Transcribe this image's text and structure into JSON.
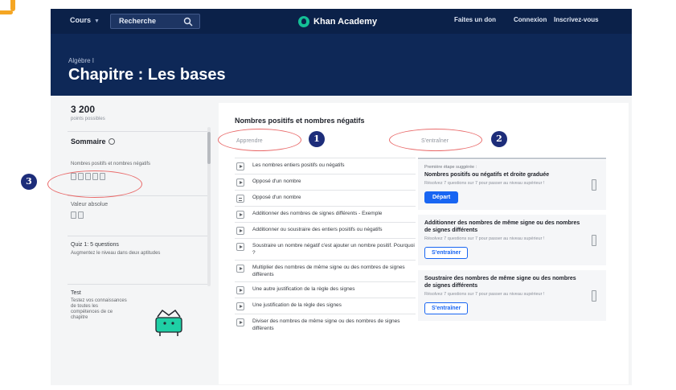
{
  "topbar": {
    "courses_label": "Cours",
    "search_placeholder": "Recherche",
    "brand": "Khan Academy",
    "donate_label": "Faites un don",
    "login_label": "Connexion",
    "signup_label": "Inscrivez-vous",
    "bg_color": "#0b2149"
  },
  "header": {
    "subtitle": "Algèbre I",
    "title": "Chapitre : Les bases",
    "bg_color": "#0e2857"
  },
  "sidebar": {
    "points": "3 200",
    "points_label": "points possibles",
    "summary_title": "Sommaire",
    "section1_label": "Nombres positifs et nombres négatifs",
    "section2_label": "Valeur absolue",
    "quiz_title": "Quiz 1: 5 questions",
    "quiz_desc": "Augmentez le niveau dans deux aptitudes",
    "test_title": "Test",
    "test_desc": "Testez vos connaissances de toutes les compétences de ce chapitre"
  },
  "annotations": [
    "1",
    "2",
    "3"
  ],
  "main": {
    "title": "Nombres positifs et nombres négatifs",
    "tab_learn": "Apprendre",
    "tab_practice": "S'entraîner",
    "rows": [
      {
        "label": "Les nombres entiers positifs ou négatifs",
        "icon": "video-icon"
      },
      {
        "label": "Opposé d'un nombre",
        "icon": "video-icon"
      },
      {
        "label": "Opposé d'un nombre",
        "icon": "article-icon"
      },
      {
        "label": "Additionner des nombres de signes différents - Exemple",
        "icon": "video-icon"
      },
      {
        "label": "Additionner ou soustraire des entiers positifs ou négatifs",
        "icon": "video-icon"
      },
      {
        "label": "Soustraire un nombre négatif c'est ajouter un nombre positif. Pourquoi ?",
        "icon": "video-icon"
      },
      {
        "label": "Multiplier des nombres de même signe ou des nombres de signes différents",
        "icon": "video-icon"
      },
      {
        "label": "Une autre justification de la règle des signes",
        "icon": "video-icon"
      },
      {
        "label": "Une justification de la règle des signes",
        "icon": "video-icon"
      },
      {
        "label": "Diviser des nombres de même signe ou des nombres de signes différents",
        "icon": "video-icon"
      }
    ],
    "cards": [
      {
        "kicker": "Première étape suggérée :",
        "title": "Nombres positifs ou négatifs et droite graduée",
        "desc": "Résolvez 7 questions sur 7 pour passer au niveau supérieur !",
        "button": "Départ",
        "primary": true
      },
      {
        "kicker": "",
        "title": "Additionner des nombres de même signe ou des nombres de signes différents",
        "desc": "Résolvez 7 questions sur 7 pour passer au niveau supérieur !",
        "button": "S'entraîner",
        "primary": false
      },
      {
        "kicker": "",
        "title": "Soustraire des nombres de même signe ou des nombres de signes différents",
        "desc": "Résolvez 7 questions sur 7 pour passer au niveau supérieur !",
        "button": "S'entraîner",
        "primary": false
      }
    ]
  },
  "colors": {
    "accent": "#1865f2",
    "annotation_ring": "#e96a6a",
    "annotation_badge": "#1d2d7a",
    "corner_mark": "#f5a623"
  }
}
